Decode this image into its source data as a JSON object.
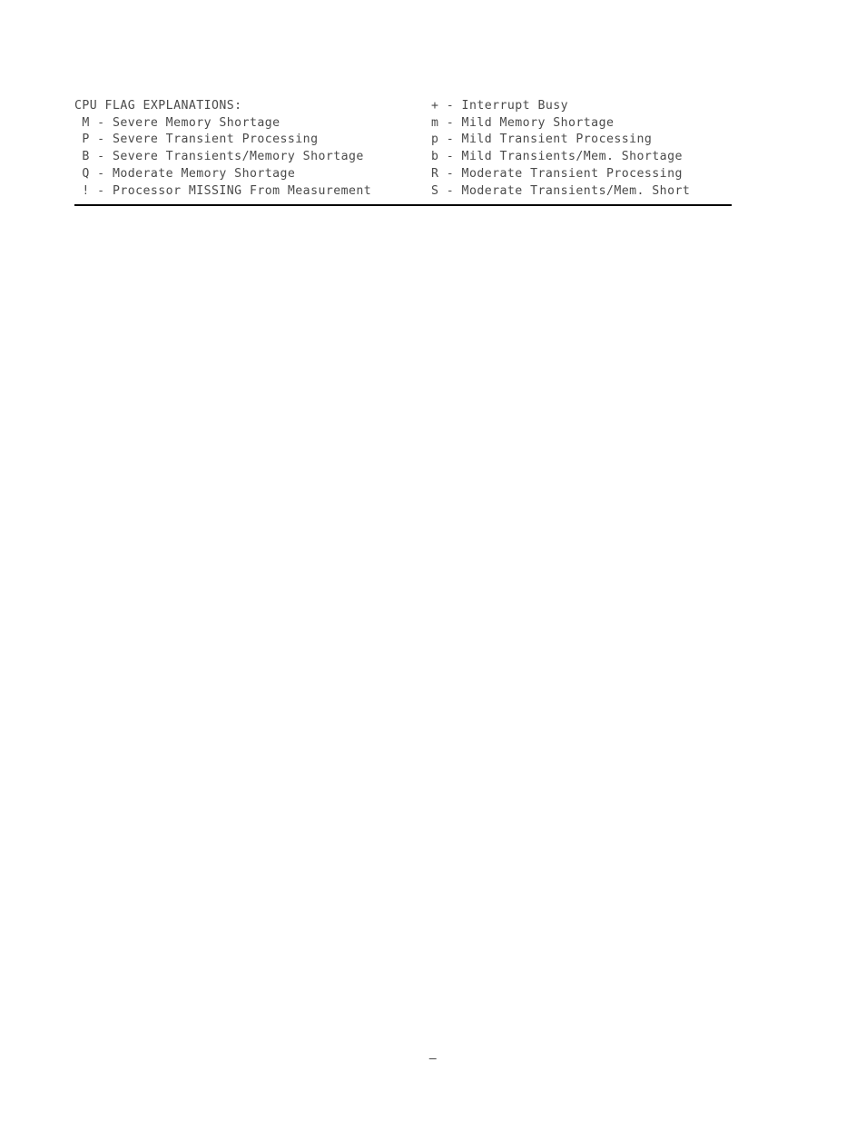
{
  "document": {
    "page_background": "#ffffff",
    "text_color": "#4a4a4a",
    "rule_color": "#000000"
  },
  "legend": {
    "title": "CPU FLAG EXPLANATIONS:",
    "rows": [
      {
        "left": {
          "code": "",
          "text": "CPU FLAG EXPLANATIONS:",
          "full": "CPU FLAG EXPLANATIONS:"
        },
        "right": {
          "code": "+",
          "text": "Interrupt Busy",
          "full": "+ - Interrupt Busy"
        }
      },
      {
        "left": {
          "code": "M",
          "text": "Severe Memory Shortage",
          "full": " M - Severe Memory Shortage"
        },
        "right": {
          "code": "m",
          "text": "Mild Memory Shortage",
          "full": "m - Mild Memory Shortage"
        }
      },
      {
        "left": {
          "code": "P",
          "text": "Severe Transient Processing",
          "full": " P - Severe Transient Processing"
        },
        "right": {
          "code": "p",
          "text": "Mild Transient Processing",
          "full": "p - Mild Transient Processing"
        }
      },
      {
        "left": {
          "code": "B",
          "text": "Severe Transients/Memory Shortage",
          "full": " B - Severe Transients/Memory Shortage"
        },
        "right": {
          "code": "b",
          "text": "Mild Transients/Mem. Shortage",
          "full": "b - Mild Transients/Mem. Shortage"
        }
      },
      {
        "left": {
          "code": "Q",
          "text": "Moderate Memory Shortage",
          "full": " Q - Moderate Memory Shortage"
        },
        "right": {
          "code": "R",
          "text": "Moderate Transient Processing",
          "full": "R - Moderate Transient Processing"
        }
      },
      {
        "left": {
          "code": "!",
          "text": "Processor MISSING From Measurement",
          "full": " ! - Processor MISSING From Measurement"
        },
        "right": {
          "code": "S",
          "text": "Moderate Transients/Mem. Short",
          "full": "S - Moderate Transients/Mem. Short"
        }
      }
    ]
  },
  "footer": {
    "mark": "–"
  }
}
